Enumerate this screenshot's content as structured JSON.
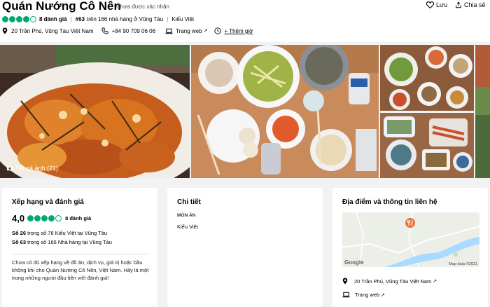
{
  "header": {
    "title": "Quán Nướng Cô Nên",
    "unclaimed": "Chưa được xác nhận",
    "save_label": "Lưu",
    "share_label": "Chia sẻ",
    "rating": 4,
    "review_count": "8 đánh giá",
    "rank_prefix": "#63",
    "rank_text": "trên 166 nhà hàng ở Vũng Tàu",
    "cuisine": "Kiểu Việt",
    "address": "20 Trần Phú, Vũng Tàu Việt Nam",
    "phone": "+84 90 709 06 06",
    "website": "Trang web",
    "add_hours": "+ Thêm giờ"
  },
  "photos": {
    "all_photos_label": "Tất cả ảnh (21)"
  },
  "ratings_card": {
    "heading": "Xếp hạng và đánh giá",
    "score": "4,0",
    "rating": 4,
    "review_count": "8 đánh giá",
    "rank1_strong": "Số 26",
    "rank1_text": "trong số 76 Kiểu Việt tại Vũng Tàu",
    "rank2_strong": "Số 63",
    "rank2_text": "trong số 166 Nhà hàng tại Vũng Tàu",
    "note": "Chưa có đủ xếp hạng về đồ ăn, dịch vụ, giá trị hoặc bầu không khí cho Quán Nướng Cô Nên, Việt Nam. Hãy là một trong những người đầu tiên viết đánh giá!"
  },
  "details_card": {
    "heading": "Chi tiết",
    "cuisine_label": "MÓN ĂN",
    "cuisine_value": "Kiểu Việt"
  },
  "location_card": {
    "heading": "Địa điểm và thông tin liên hệ",
    "map_logo": "Google",
    "map_data": "Map data ©2021",
    "address": "20 Trần Phú, Vũng Tàu Việt Nam",
    "website": "Trang web"
  },
  "colors": {
    "brand_green": "#00aa6c",
    "map_pin": "#e8743b",
    "map_water": "#aadaff"
  }
}
